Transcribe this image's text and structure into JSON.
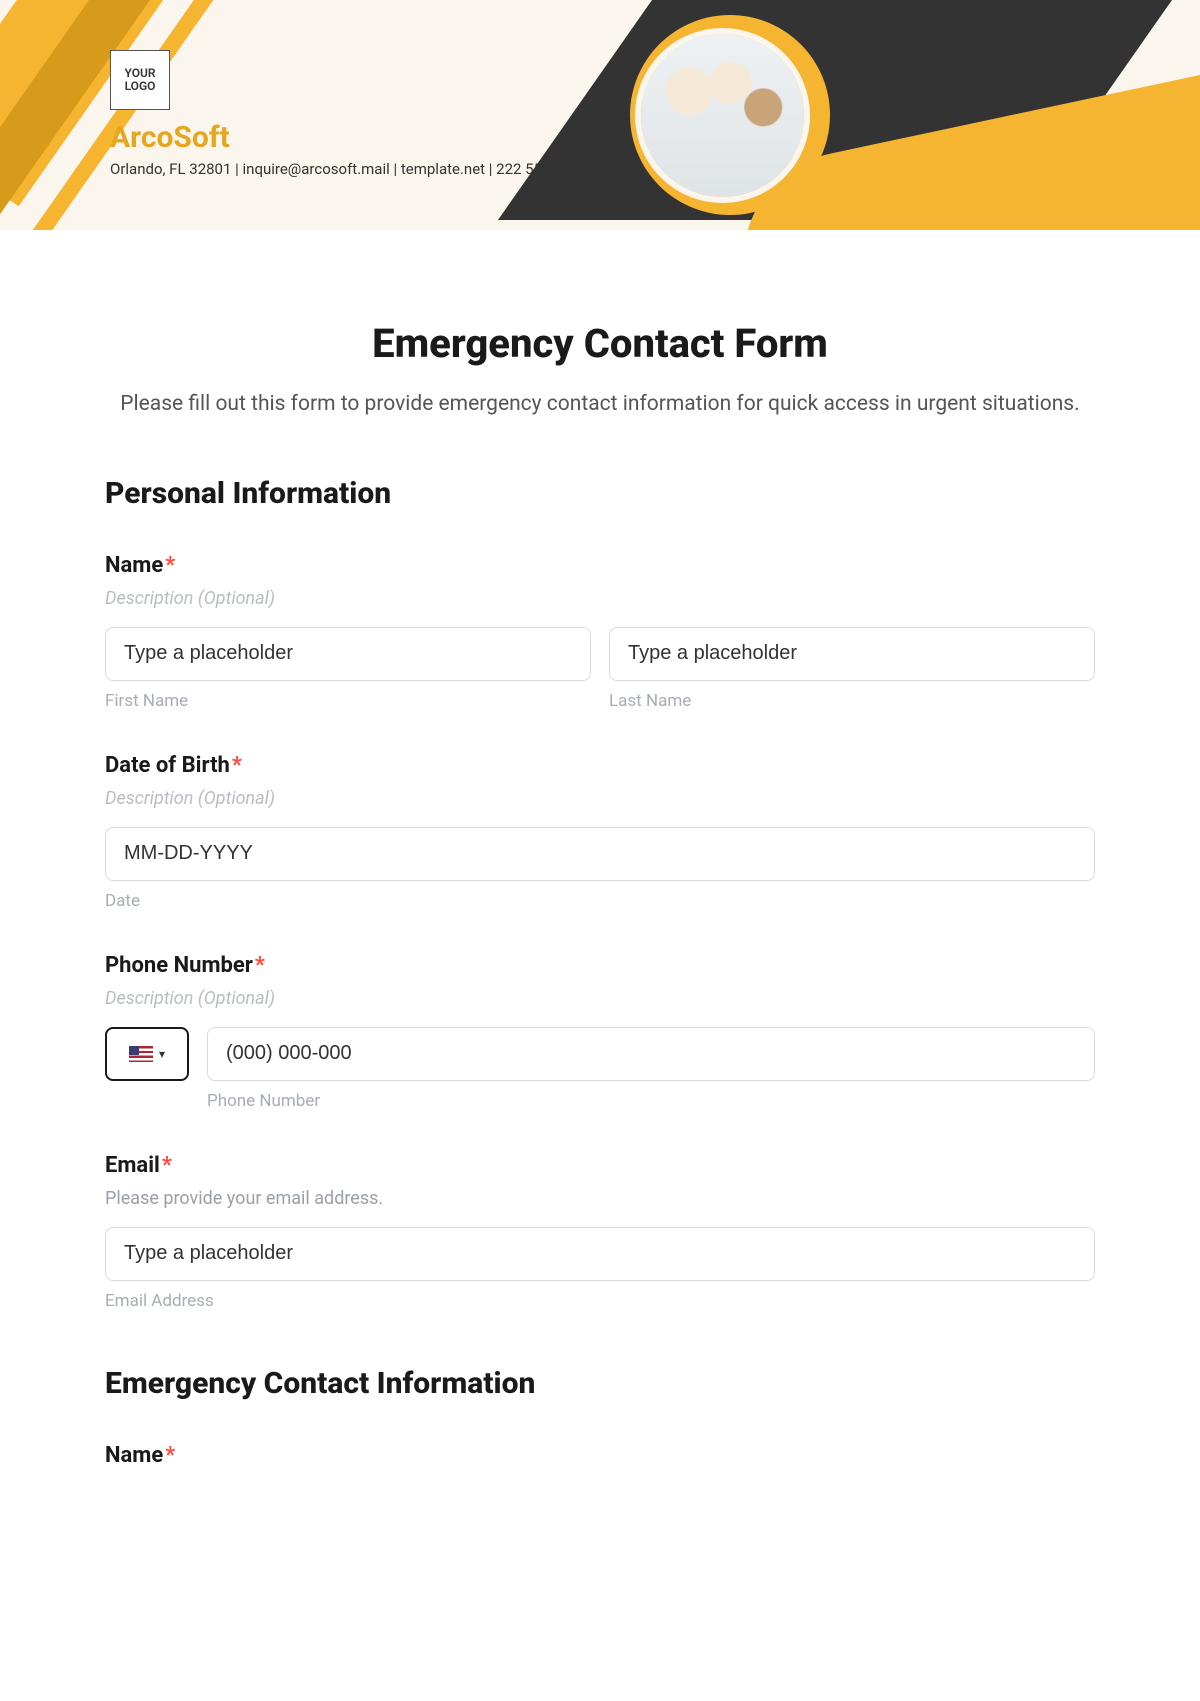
{
  "header": {
    "logo_text": "YOUR\nLOGO",
    "company": "ArcoSoft",
    "tagline": "Orlando, FL 32801 | inquire@arcosoft.mail | template.net | 222 555 777"
  },
  "form": {
    "title": "Emergency Contact Form",
    "subtitle": "Please fill out this form to provide emergency contact information for quick access in urgent situations.",
    "section_personal": "Personal Information",
    "section_emergency": "Emergency Contact Information",
    "desc_optional": "Description (Optional)",
    "name": {
      "label": "Name",
      "first_placeholder": "Type a placeholder",
      "last_placeholder": "Type a placeholder",
      "first_sub": "First Name",
      "last_sub": "Last Name"
    },
    "dob": {
      "label": "Date of Birth",
      "placeholder": "MM-DD-YYYY",
      "sub": "Date"
    },
    "phone": {
      "label": "Phone Number",
      "placeholder": "(000) 000-000",
      "sub": "Phone Number"
    },
    "email": {
      "label": "Email",
      "desc": "Please provide your email address.",
      "placeholder": "Type a placeholder",
      "sub": "Email Address"
    },
    "ec_name": {
      "label": "Name"
    }
  }
}
